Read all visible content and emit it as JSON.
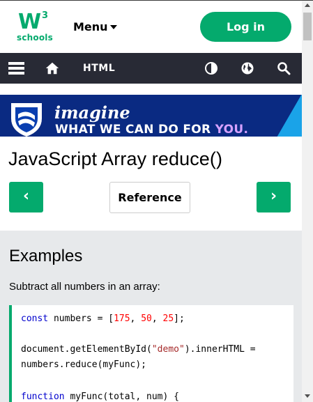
{
  "header": {
    "logo_mark": "W",
    "logo_sup": "3",
    "logo_text": "schools",
    "menu_label": "Menu",
    "login_label": "Log in"
  },
  "nav": {
    "section_label": "HTML",
    "icons": [
      "menu-icon",
      "home-icon",
      "contrast-icon",
      "globe-icon",
      "search-icon"
    ]
  },
  "ad": {
    "headline": "imagine",
    "tagline_main": "WHAT WE CAN DO FOR ",
    "tagline_highlight": "YOU."
  },
  "page": {
    "title": "JavaScript Array reduce()",
    "prev_label": "‹",
    "reference_label": "Reference",
    "next_label": "›"
  },
  "example": {
    "heading": "Examples",
    "description": "Subtract all numbers in an array:",
    "code": {
      "line1": {
        "kw": "const",
        "a": " numbers = [",
        "n1": "175",
        "s1": ", ",
        "n2": "50",
        "s2": ", ",
        "n3": "25",
        "end": "];"
      },
      "line3": {
        "a": "document.getElementById(",
        "str": "\"demo\"",
        "b": ").innerHTML ="
      },
      "line4": "numbers.reduce(myFunc);",
      "line6": {
        "kw": "function",
        "a": " myFunc(total, num) {"
      }
    }
  },
  "colors": {
    "brand_green": "#04AA6D",
    "nav_dark": "#282A35",
    "example_bg": "#E7E9EB"
  }
}
